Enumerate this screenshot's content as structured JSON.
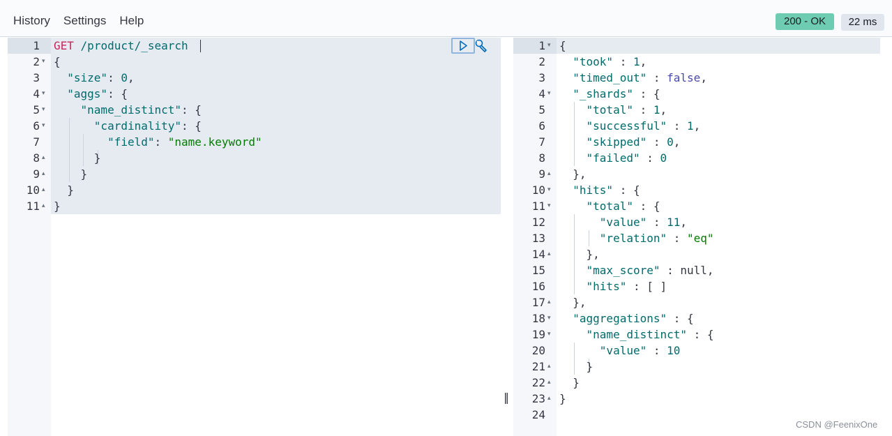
{
  "menu": {
    "history": "History",
    "settings": "Settings",
    "help": "Help"
  },
  "status": {
    "code_text": "200 - OK",
    "time_text": "22 ms"
  },
  "request": {
    "lines": [
      {
        "n": "1",
        "fold": "",
        "tokens": [
          [
            "method",
            "GET"
          ],
          [
            "p",
            " "
          ],
          [
            "url",
            "/product/_search"
          ]
        ]
      },
      {
        "n": "2",
        "fold": "▾",
        "tokens": [
          [
            "p",
            "{"
          ]
        ]
      },
      {
        "n": "3",
        "fold": "",
        "tokens": [
          [
            "p",
            "  "
          ],
          [
            "k",
            "\"size\""
          ],
          [
            "p",
            ": "
          ],
          [
            "n",
            "0"
          ],
          [
            "p",
            ","
          ]
        ]
      },
      {
        "n": "4",
        "fold": "▾",
        "tokens": [
          [
            "p",
            "  "
          ],
          [
            "k",
            "\"aggs\""
          ],
          [
            "p",
            ": {"
          ]
        ]
      },
      {
        "n": "5",
        "fold": "▾",
        "tokens": [
          [
            "p",
            "    "
          ],
          [
            "k",
            "\"name_distinct\""
          ],
          [
            "p",
            ": {"
          ]
        ]
      },
      {
        "n": "6",
        "fold": "▾",
        "tokens": [
          [
            "p",
            "      "
          ],
          [
            "k",
            "\"cardinality\""
          ],
          [
            "p",
            ": {"
          ]
        ]
      },
      {
        "n": "7",
        "fold": "",
        "tokens": [
          [
            "p",
            "        "
          ],
          [
            "k",
            "\"field\""
          ],
          [
            "p",
            ": "
          ],
          [
            "s",
            "\"name.keyword\""
          ]
        ]
      },
      {
        "n": "8",
        "fold": "▴",
        "tokens": [
          [
            "p",
            "      }"
          ]
        ]
      },
      {
        "n": "9",
        "fold": "▴",
        "tokens": [
          [
            "p",
            "    }"
          ]
        ]
      },
      {
        "n": "10",
        "fold": "▴",
        "tokens": [
          [
            "p",
            "  }"
          ]
        ]
      },
      {
        "n": "11",
        "fold": "▴",
        "tokens": [
          [
            "p",
            "}"
          ]
        ]
      }
    ]
  },
  "response": {
    "lines": [
      {
        "n": "1",
        "fold": "▾",
        "tokens": [
          [
            "p",
            "{"
          ]
        ]
      },
      {
        "n": "2",
        "fold": "",
        "tokens": [
          [
            "p",
            "  "
          ],
          [
            "k",
            "\"took\""
          ],
          [
            "p",
            " : "
          ],
          [
            "n",
            "1"
          ],
          [
            "p",
            ","
          ]
        ]
      },
      {
        "n": "3",
        "fold": "",
        "tokens": [
          [
            "p",
            "  "
          ],
          [
            "k",
            "\"timed_out\""
          ],
          [
            "p",
            " : "
          ],
          [
            "kw",
            "false"
          ],
          [
            "p",
            ","
          ]
        ]
      },
      {
        "n": "4",
        "fold": "▾",
        "tokens": [
          [
            "p",
            "  "
          ],
          [
            "k",
            "\"_shards\""
          ],
          [
            "p",
            " : {"
          ]
        ]
      },
      {
        "n": "5",
        "fold": "",
        "tokens": [
          [
            "p",
            "    "
          ],
          [
            "k",
            "\"total\""
          ],
          [
            "p",
            " : "
          ],
          [
            "n",
            "1"
          ],
          [
            "p",
            ","
          ]
        ]
      },
      {
        "n": "6",
        "fold": "",
        "tokens": [
          [
            "p",
            "    "
          ],
          [
            "k",
            "\"successful\""
          ],
          [
            "p",
            " : "
          ],
          [
            "n",
            "1"
          ],
          [
            "p",
            ","
          ]
        ]
      },
      {
        "n": "7",
        "fold": "",
        "tokens": [
          [
            "p",
            "    "
          ],
          [
            "k",
            "\"skipped\""
          ],
          [
            "p",
            " : "
          ],
          [
            "n",
            "0"
          ],
          [
            "p",
            ","
          ]
        ]
      },
      {
        "n": "8",
        "fold": "",
        "tokens": [
          [
            "p",
            "    "
          ],
          [
            "k",
            "\"failed\""
          ],
          [
            "p",
            " : "
          ],
          [
            "n",
            "0"
          ]
        ]
      },
      {
        "n": "9",
        "fold": "▴",
        "tokens": [
          [
            "p",
            "  },"
          ]
        ]
      },
      {
        "n": "10",
        "fold": "▾",
        "tokens": [
          [
            "p",
            "  "
          ],
          [
            "k",
            "\"hits\""
          ],
          [
            "p",
            " : {"
          ]
        ]
      },
      {
        "n": "11",
        "fold": "▾",
        "tokens": [
          [
            "p",
            "    "
          ],
          [
            "k",
            "\"total\""
          ],
          [
            "p",
            " : {"
          ]
        ]
      },
      {
        "n": "12",
        "fold": "",
        "tokens": [
          [
            "p",
            "      "
          ],
          [
            "k",
            "\"value\""
          ],
          [
            "p",
            " : "
          ],
          [
            "n",
            "11"
          ],
          [
            "p",
            ","
          ]
        ]
      },
      {
        "n": "13",
        "fold": "",
        "tokens": [
          [
            "p",
            "      "
          ],
          [
            "k",
            "\"relation\""
          ],
          [
            "p",
            " : "
          ],
          [
            "s",
            "\"eq\""
          ]
        ]
      },
      {
        "n": "14",
        "fold": "▴",
        "tokens": [
          [
            "p",
            "    },"
          ]
        ]
      },
      {
        "n": "15",
        "fold": "",
        "tokens": [
          [
            "p",
            "    "
          ],
          [
            "k",
            "\"max_score\""
          ],
          [
            "p",
            " : null,"
          ]
        ]
      },
      {
        "n": "16",
        "fold": "",
        "tokens": [
          [
            "p",
            "    "
          ],
          [
            "k",
            "\"hits\""
          ],
          [
            "p",
            " : [ ]"
          ]
        ]
      },
      {
        "n": "17",
        "fold": "▴",
        "tokens": [
          [
            "p",
            "  },"
          ]
        ]
      },
      {
        "n": "18",
        "fold": "▾",
        "tokens": [
          [
            "p",
            "  "
          ],
          [
            "k",
            "\"aggregations\""
          ],
          [
            "p",
            " : {"
          ]
        ]
      },
      {
        "n": "19",
        "fold": "▾",
        "tokens": [
          [
            "p",
            "    "
          ],
          [
            "k",
            "\"name_distinct\""
          ],
          [
            "p",
            " : {"
          ]
        ]
      },
      {
        "n": "20",
        "fold": "",
        "tokens": [
          [
            "p",
            "      "
          ],
          [
            "k",
            "\"value\""
          ],
          [
            "p",
            " : "
          ],
          [
            "n",
            "10"
          ]
        ]
      },
      {
        "n": "21",
        "fold": "▴",
        "tokens": [
          [
            "p",
            "    }"
          ]
        ]
      },
      {
        "n": "22",
        "fold": "▴",
        "tokens": [
          [
            "p",
            "  }"
          ]
        ]
      },
      {
        "n": "23",
        "fold": "▴",
        "tokens": [
          [
            "p",
            "}"
          ]
        ]
      },
      {
        "n": "24",
        "fold": "",
        "tokens": []
      }
    ]
  },
  "icons": {
    "run": "play-icon",
    "settings": "wrench-icon",
    "divider": "resize-handle-icon"
  },
  "divider_glyph": "‖",
  "watermark": "CSDN @FeenixOne",
  "colors": {
    "status_ok": "#6dccb1",
    "timing_badge": "#e0e5ee",
    "key": "#006b6b",
    "string": "#017d01",
    "method": "#c4275a",
    "boolean": "#4a4aa8"
  }
}
